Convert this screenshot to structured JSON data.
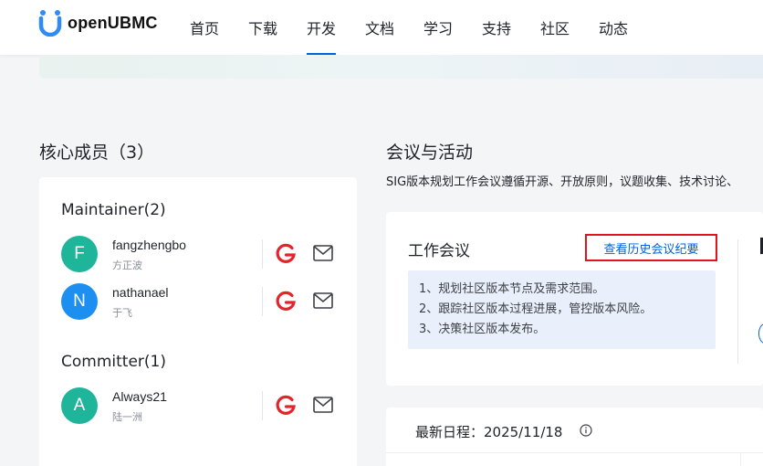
{
  "header": {
    "logo_text": "openUBMC",
    "nav": [
      "首页",
      "下载",
      "开发",
      "文档",
      "学习",
      "支持",
      "社区",
      "动态"
    ],
    "active_index": 2,
    "accent_color": "#0062dc"
  },
  "members": {
    "title": "核心成员（3）",
    "groups": [
      {
        "title": "Maintainer(2)",
        "people": [
          {
            "initial": "F",
            "name": "fangzhengbo",
            "cn_name": "方正波",
            "avatar_color": "#1fb59a"
          },
          {
            "initial": "N",
            "name": "nathanael",
            "cn_name": "于飞",
            "avatar_color": "#1c8ff0"
          }
        ]
      },
      {
        "title": "Committer(1)",
        "people": [
          {
            "initial": "A",
            "name": "Always21",
            "cn_name": "陆一洲",
            "avatar_color": "#1fb59a"
          }
        ]
      }
    ]
  },
  "meetings": {
    "title": "会议与活动",
    "description": "SIG版本规划工作会议遵循开源、开放原则，议题收集、技术讨论、",
    "work": {
      "title": "工作会议",
      "history_button": "查看历史会议纪要",
      "items": [
        "1、规划社区版本节点及需求范围。",
        "2、跟踪社区版本过程进展，管控版本风险。",
        "3、决策社区版本发布。"
      ]
    },
    "schedule": {
      "label": "最新日程：2025/11/18"
    }
  },
  "icons": {
    "gitcode": "gitcode-g-icon",
    "mail": "mail-icon",
    "info": "info-icon"
  }
}
